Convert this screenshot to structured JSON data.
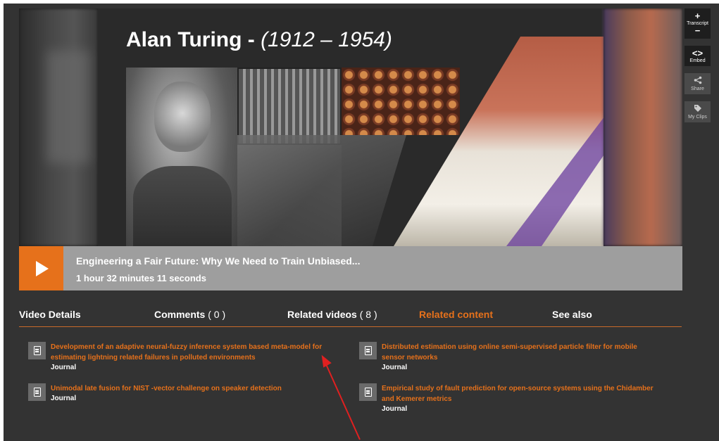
{
  "slide": {
    "name": "Alan Turing",
    "separator": " - ",
    "years": "(1912 – 1954)"
  },
  "sidebar": {
    "transcript": {
      "label": "Transcript",
      "plus": "+",
      "minus": "−"
    },
    "embed": {
      "label": "Embed",
      "glyph": "<>"
    },
    "share": {
      "label": "Share"
    },
    "clips": {
      "label": "My Clips"
    }
  },
  "video": {
    "title": "Engineering a Fair Future: Why We Need to Train Unbiased...",
    "duration": "1 hour 32 minutes 11 seconds"
  },
  "tabs": {
    "details": "Video Details",
    "comments": "Comments",
    "comments_count": "( 0 )",
    "related_videos": "Related videos",
    "related_videos_count": "( 8 )",
    "related_content": "Related content",
    "see_also": "See also"
  },
  "items": [
    {
      "title_line1": "Development of an adaptive neural-fuzzy inference system based meta-model for",
      "title_line2": "estimating lightning related failures in polluted environments",
      "type": "Journal"
    },
    {
      "title_line1": "Distributed estimation using online semi-supervised particle filter for mobile",
      "title_line2": "sensor networks",
      "type": "Journal"
    },
    {
      "title_line1": "Unimodal late fusion for NIST -vector challenge on speaker detection",
      "title_line2": "",
      "type": "Journal"
    },
    {
      "title_line1": "Empirical study of fault prediction for open-source systems using the Chidamber",
      "title_line2": "and Kemerer metrics",
      "type": "Journal"
    }
  ],
  "colors": {
    "accent": "#e6711b",
    "background": "#333333",
    "annotation": "#e02020"
  }
}
